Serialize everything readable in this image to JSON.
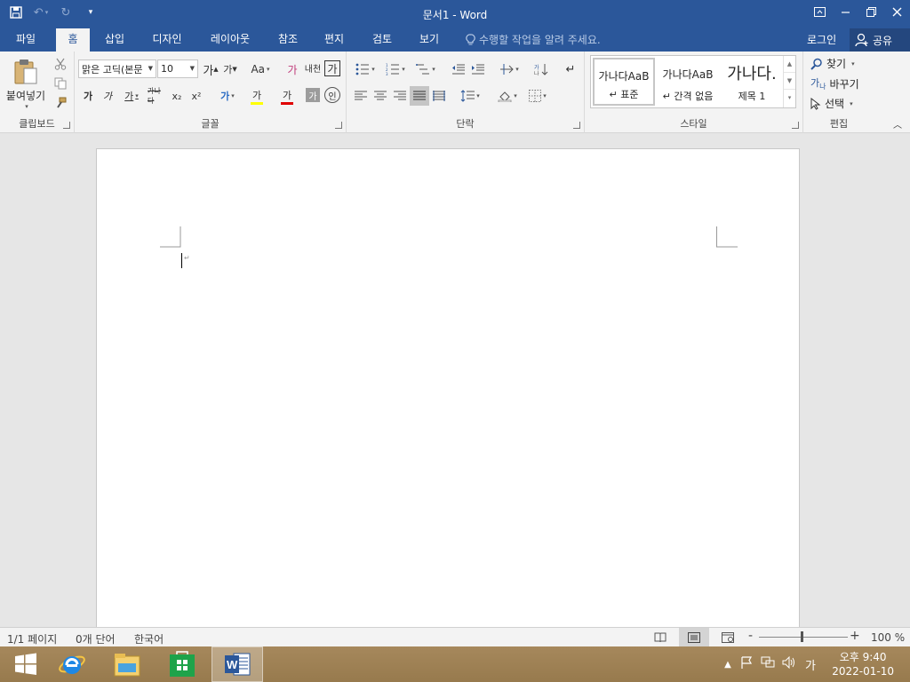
{
  "window": {
    "title": "문서1 - Word",
    "controls": {
      "ribbon_options": "ribbon-display-options",
      "minimize": "minimize",
      "restore": "restore",
      "close": "close"
    }
  },
  "tabs": {
    "file": "파일",
    "home": "홈",
    "insert": "삽입",
    "design": "디자인",
    "layout": "레이아웃",
    "references": "참조",
    "mailings": "편지",
    "review": "검토",
    "view": "보기",
    "tell_me": "수행할 작업을 알려 주세요.",
    "sign_in": "로그인",
    "share": "공유"
  },
  "ribbon": {
    "clipboard": {
      "label": "클립보드",
      "paste": "붙여넣기"
    },
    "font": {
      "label": "글꼴",
      "font_name": "맑은 고딕(본문",
      "font_size": "10",
      "change_case": "Aa",
      "phonetic": "내천",
      "bold": "가",
      "italic": "가",
      "underline": "가",
      "strike": "가나다",
      "subscript": "x₂",
      "superscript": "x²",
      "text_effect": "가",
      "highlight": "가",
      "font_color": "가",
      "char_shading": "가",
      "enclose": "인",
      "grow": "가",
      "shrink": "가",
      "clear": "가",
      "char_border": "가"
    },
    "paragraph": {
      "label": "단락"
    },
    "styles": {
      "label": "스타일",
      "items": [
        {
          "preview": "가나다AaB",
          "name": "표준"
        },
        {
          "preview": "가나다AaB",
          "name": "간격 없음"
        },
        {
          "preview": "가나다.",
          "name": "제목 1"
        }
      ]
    },
    "editing": {
      "label": "편집",
      "find": "찾기",
      "replace": "바꾸기",
      "select": "선택"
    }
  },
  "statusbar": {
    "page": "1/1 페이지",
    "words": "0개 단어",
    "language": "한국어",
    "zoom": "100 %",
    "zoom_minus": "-",
    "zoom_plus": "+",
    "zoom_level": 1.0
  },
  "taskbar": {
    "ime": "가",
    "time": "오후 9:40",
    "date": "2022-01-10"
  },
  "colors": {
    "word_blue": "#2b579a",
    "highlight_yellow": "#ffff00",
    "font_red": "#e00000"
  }
}
